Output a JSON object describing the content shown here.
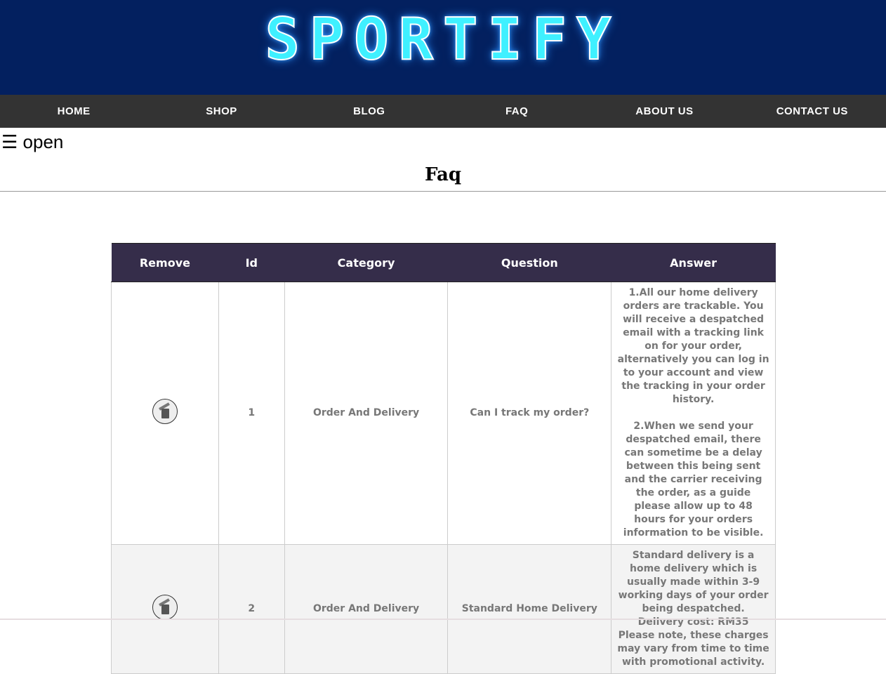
{
  "brand": "SPORTIFY",
  "nav": [
    "HOME",
    "SHOP",
    "BLOG",
    "FAQ",
    "ABOUT US",
    "CONTACT US"
  ],
  "menu_toggle": "☰ open",
  "page_title": "Faq",
  "table": {
    "headers": [
      "Remove",
      "Id",
      "Category",
      "Question",
      "Answer"
    ],
    "rows": [
      {
        "id": "1",
        "category": "Order And Delivery",
        "question": "Can I track my order?",
        "answer": [
          "1.All our home delivery orders are trackable. You will receive a despatched email with a tracking link on for your order, alternatively you can log in to your account and view the tracking in your order history.",
          "2.When we send your despatched email, there can sometime be a delay between this being sent and the carrier receiving the order, as a guide please allow up to 48 hours for your orders information to be visible."
        ]
      },
      {
        "id": "2",
        "category": "Order And Delivery",
        "question": "Standard Home Delivery",
        "answer": [
          "Standard delivery is a home delivery which is usually made within 3-9 working days of your order being despatched.",
          "Delivery cost: RM35",
          "Please note, these charges may vary from time to time with promotional activity."
        ]
      }
    ]
  }
}
